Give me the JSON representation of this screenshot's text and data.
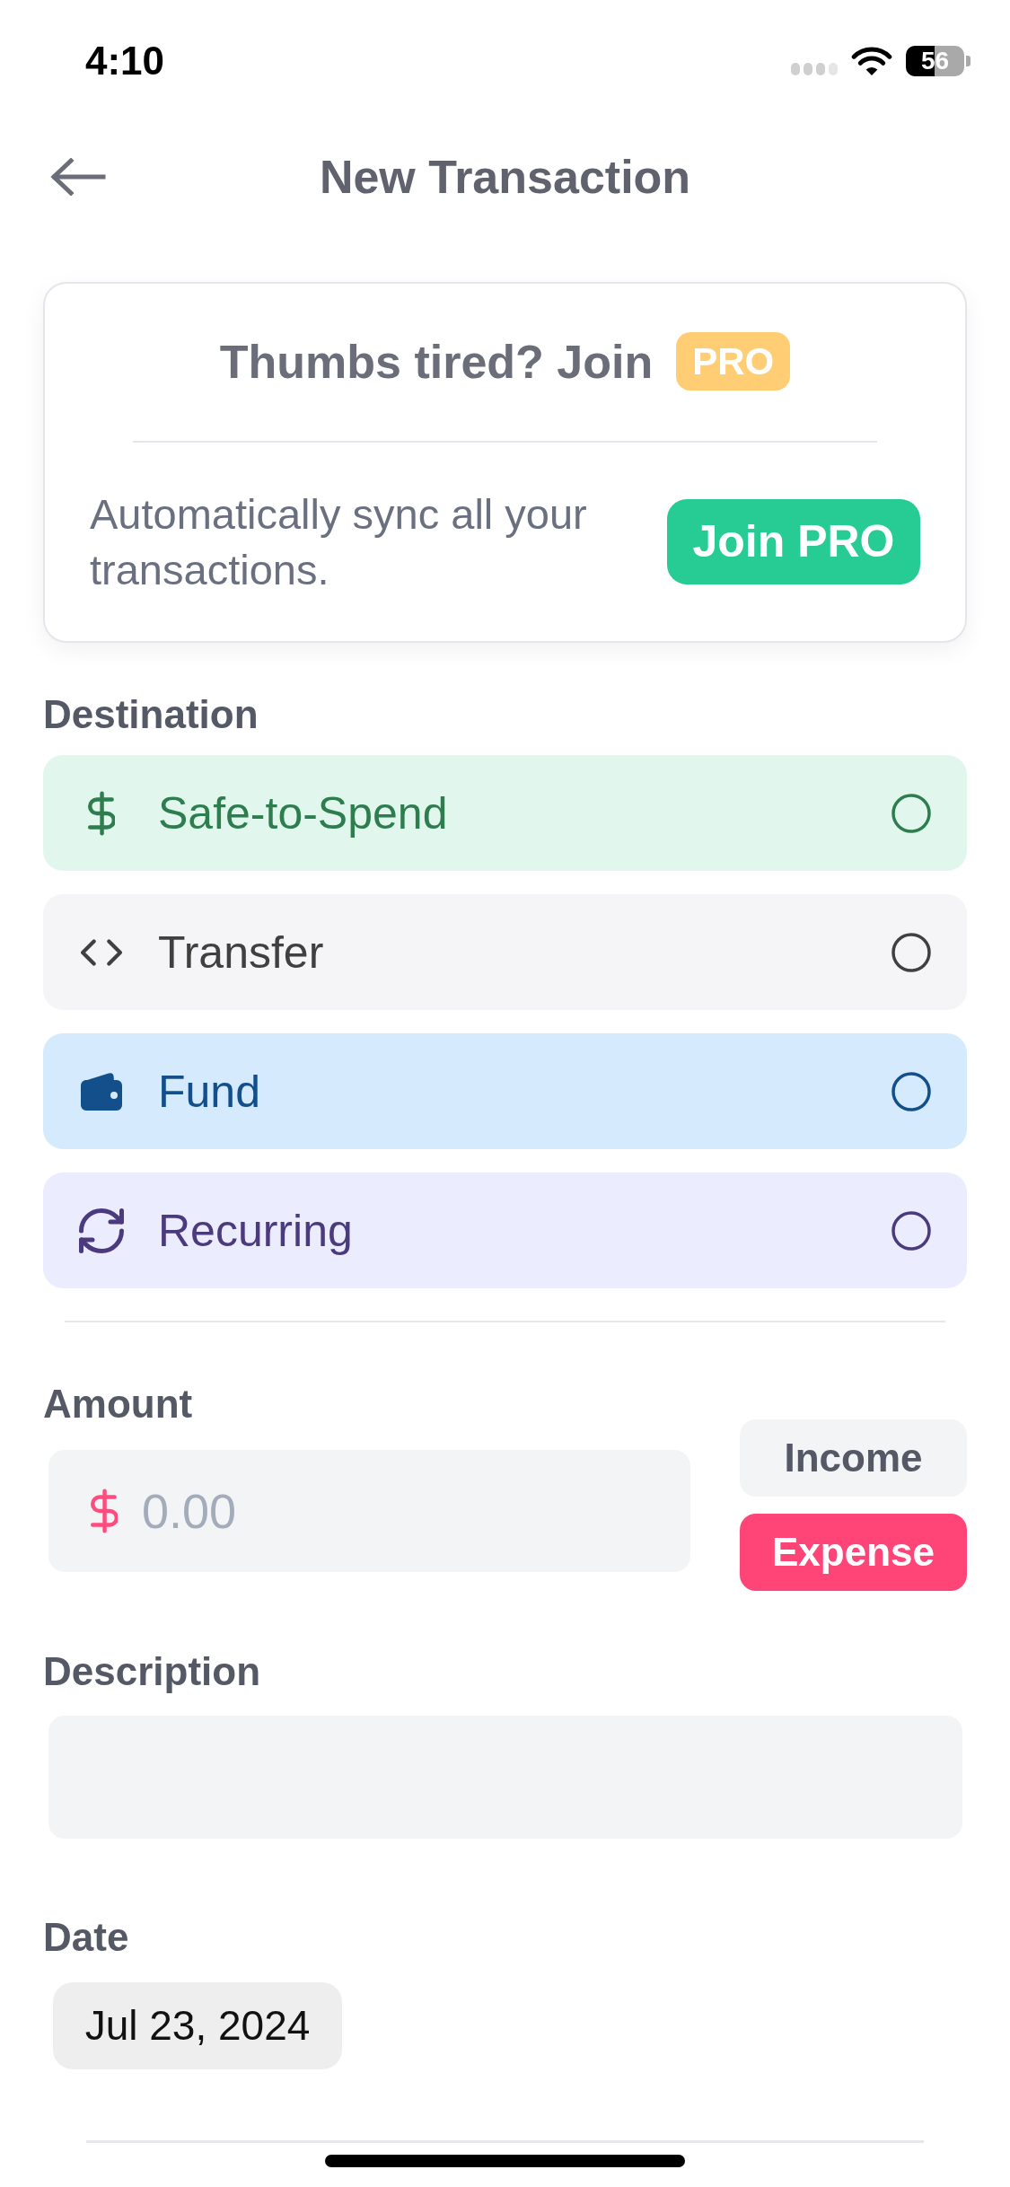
{
  "status_bar": {
    "time": "4:10",
    "battery": "56"
  },
  "header": {
    "title": "New Transaction"
  },
  "promo": {
    "title": "Thumbs tired? Join",
    "badge": "PRO",
    "text": "Automatically sync all your transactions.",
    "button": "Join PRO"
  },
  "destination": {
    "label": "Destination",
    "options": [
      {
        "kind": "spend",
        "label": "Safe-to-Spend",
        "selected": false,
        "color": "#2e7d4f"
      },
      {
        "kind": "transfer",
        "label": "Transfer",
        "selected": false,
        "color": "#404040"
      },
      {
        "kind": "fund",
        "label": "Fund",
        "selected": false,
        "color": "#134f8a"
      },
      {
        "kind": "recurring",
        "label": "Recurring",
        "selected": false,
        "color": "#4b3a7d"
      }
    ]
  },
  "amount": {
    "label": "Amount",
    "placeholder": "0.00",
    "types": [
      {
        "label": "Income",
        "selected": false
      },
      {
        "label": "Expense",
        "selected": true
      }
    ]
  },
  "description": {
    "label": "Description"
  },
  "date": {
    "label": "Date",
    "value": "Jul 23, 2024"
  }
}
